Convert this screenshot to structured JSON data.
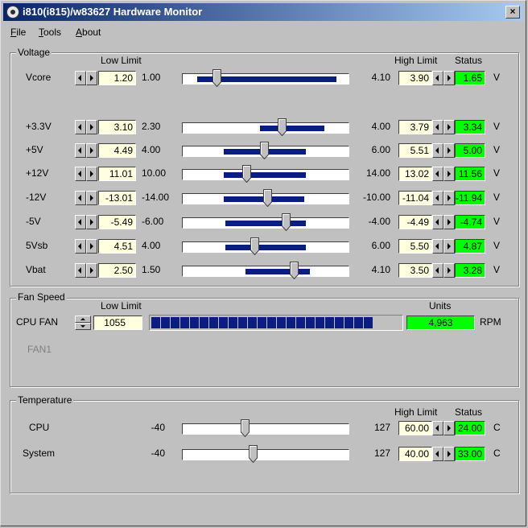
{
  "window": {
    "title": "i810(i815)/w83627 Hardware Monitor",
    "close_label": "×"
  },
  "menu": [
    {
      "key": "F",
      "rest": "ile"
    },
    {
      "key": "T",
      "rest": "ools"
    },
    {
      "key": "A",
      "rest": "bout"
    }
  ],
  "voltage": {
    "legend": "Voltage",
    "low_limit_header": "Low Limit",
    "high_limit_header": "High Limit",
    "status_header": "Status",
    "unit": "V",
    "rows": [
      {
        "name": "Vcore",
        "low": "1.20",
        "min": "1.00",
        "max": "4.10",
        "high": "3.90",
        "status": "1.65",
        "range_start": 0.09,
        "range_end": 0.94,
        "thumb": 0.21
      },
      {
        "name": "+3.3V",
        "low": "3.10",
        "min": "2.30",
        "max": "4.00",
        "high": "3.79",
        "status": "3.34",
        "range_start": 0.47,
        "range_end": 0.86,
        "thumb": 0.61
      },
      {
        "name": "+5V",
        "low": "4.49",
        "min": "4.00",
        "max": "6.00",
        "high": "5.51",
        "status": "5.00",
        "range_start": 0.25,
        "range_end": 0.75,
        "thumb": 0.5
      },
      {
        "name": "+12V",
        "low": "11.01",
        "min": "10.00",
        "max": "14.00",
        "high": "13.02",
        "status": "11.56",
        "range_start": 0.25,
        "range_end": 0.75,
        "thumb": 0.39
      },
      {
        "name": "-12V",
        "low": "-13.01",
        "min": "-14.00",
        "max": "-10.00",
        "high": "-11.04",
        "status": "-11.94",
        "range_start": 0.25,
        "range_end": 0.74,
        "thumb": 0.52
      },
      {
        "name": "-5V",
        "low": "-5.49",
        "min": "-6.00",
        "max": "-4.00",
        "high": "-4.49",
        "status": "-4.74",
        "range_start": 0.26,
        "range_end": 0.75,
        "thumb": 0.63
      },
      {
        "name": "5Vsb",
        "low": "4.51",
        "min": "4.00",
        "max": "6.00",
        "high": "5.50",
        "status": "4.87",
        "range_start": 0.26,
        "range_end": 0.75,
        "thumb": 0.44
      },
      {
        "name": "Vbat",
        "low": "2.50",
        "min": "1.50",
        "max": "4.10",
        "high": "3.50",
        "status": "3.28",
        "range_start": 0.38,
        "range_end": 0.77,
        "thumb": 0.68
      }
    ]
  },
  "fan": {
    "legend": "Fan Speed",
    "low_limit_header": "Low Limit",
    "units_header": "Units",
    "rows": [
      {
        "name": "CPU FAN",
        "low": "1055",
        "value": "4,963",
        "unit": "RPM",
        "blocks": 23
      }
    ],
    "disabled_row": "FAN1"
  },
  "temperature": {
    "legend": "Temperature",
    "high_limit_header": "High Limit",
    "status_header": "Status",
    "unit": "C",
    "rows": [
      {
        "name": "CPU",
        "min": "-40",
        "max": "127",
        "high": "60.00",
        "status": "24.00",
        "thumb": 0.38
      },
      {
        "name": "System",
        "min": "-40",
        "max": "127",
        "high": "40.00",
        "status": "33.00",
        "thumb": 0.43
      }
    ]
  },
  "colors": {
    "titlebar_start": "#0a246a",
    "titlebar_end": "#a6caf0",
    "status_ok": "#00ff00",
    "range_fill": "#0a1e80",
    "field_bg": "#ffffe0"
  }
}
